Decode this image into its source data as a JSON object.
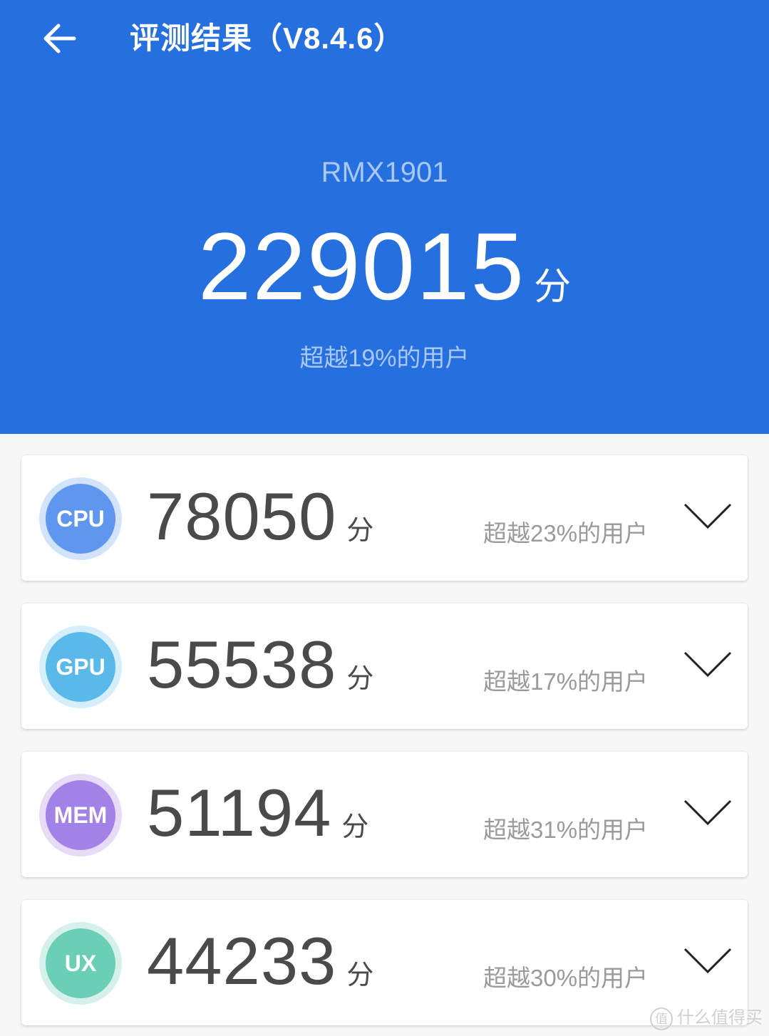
{
  "header": {
    "title": "评测结果（V8.4.6）",
    "back_icon": "arrow-left-icon",
    "model": "RMX1901",
    "total_score": "229015",
    "unit": "分",
    "rank_text": "超越19%的用户",
    "bg_color": "#266fdf"
  },
  "cards": [
    {
      "label": "CPU",
      "score": "78050",
      "unit": "分",
      "rank_text": "超越23%的用户",
      "color": "#5f97ee",
      "ring": "#d3e3fb",
      "icon": "chevron-down-icon"
    },
    {
      "label": "GPU",
      "score": "55538",
      "unit": "分",
      "rank_text": "超越17%的用户",
      "color": "#5ab9e9",
      "ring": "#d4eefa",
      "icon": "chevron-down-icon"
    },
    {
      "label": "MEM",
      "score": "51194",
      "unit": "分",
      "rank_text": "超越31%的用户",
      "color": "#a282e6",
      "ring": "#e6dcf8",
      "icon": "chevron-down-icon"
    },
    {
      "label": "UX",
      "score": "44233",
      "unit": "分",
      "rank_text": "超越30%的用户",
      "color": "#6acfb5",
      "ring": "#d6f1ea",
      "icon": "chevron-down-icon"
    }
  ],
  "watermark": {
    "circle_char": "值",
    "text": "什么值得买"
  }
}
